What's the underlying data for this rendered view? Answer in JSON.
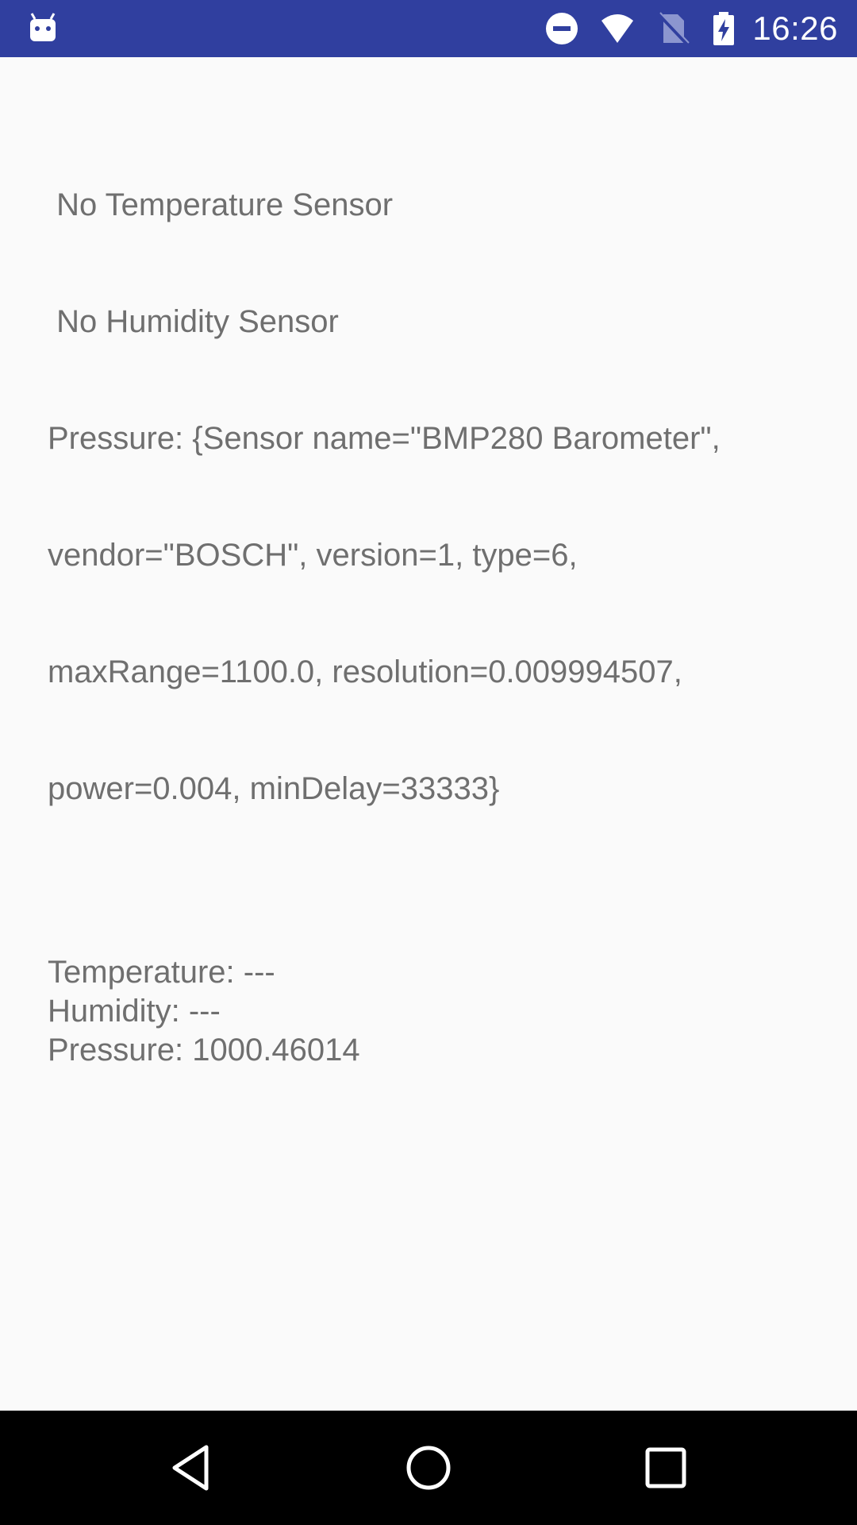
{
  "status_bar": {
    "time": "16:26",
    "bg_color": "#303f9f",
    "icons": [
      "android-debug-icon",
      "do-not-disturb-icon",
      "wifi-icon",
      "no-sim-icon",
      "battery-charging-icon"
    ]
  },
  "sensor_info": {
    "lines": [
      " No Temperature Sensor",
      " No Humidity Sensor",
      "Pressure: {Sensor name=\"BMP280 Barometer\",",
      "vendor=\"BOSCH\", version=1, type=6,",
      "maxRange=1100.0, resolution=0.009994507,",
      "power=0.004, minDelay=33333}"
    ]
  },
  "readings": {
    "temperature": "Temperature: ---",
    "humidity": "Humidity: ---",
    "pressure": "Pressure: 1000.46014"
  },
  "nav_bar": {
    "buttons": [
      "back-icon",
      "home-icon",
      "recents-icon"
    ]
  }
}
